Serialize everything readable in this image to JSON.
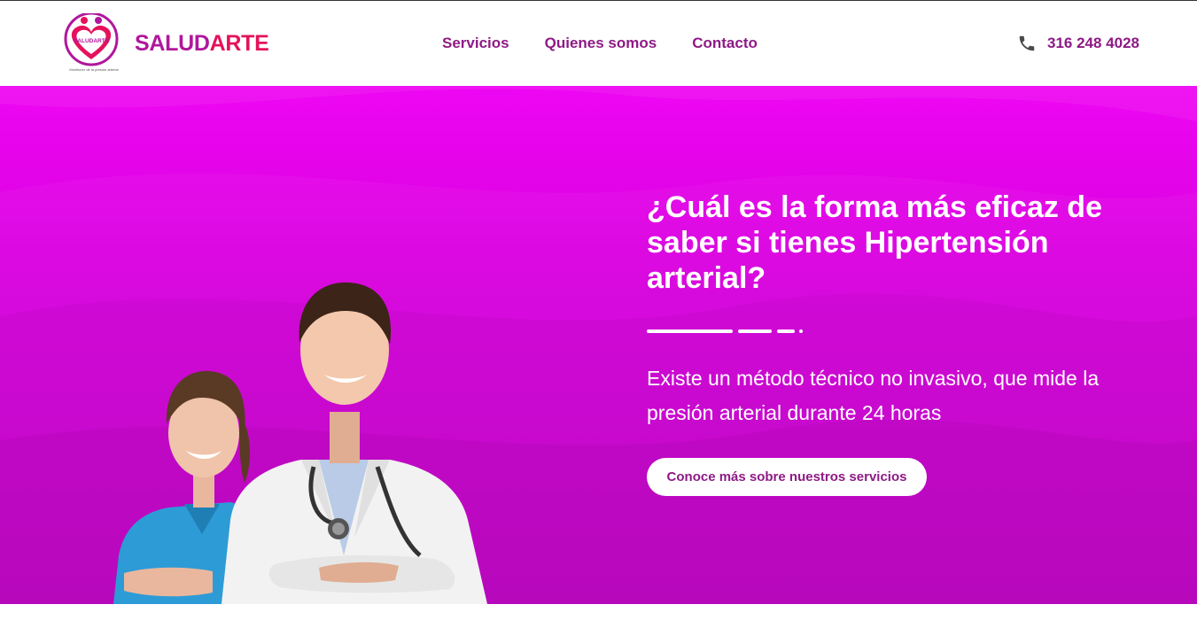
{
  "colors": {
    "brand_primary": "#b0179c",
    "brand_secondary": "#e5125b",
    "nav_text": "#8e1a86",
    "hero_top": "#ee06f3",
    "hero_bottom": "#c400c9",
    "white": "#ffffff"
  },
  "header": {
    "logo": {
      "badge_text": "SALUDARTE",
      "tagline": "Monitoreo de la presión arterial",
      "icon": "heart-logo-icon"
    },
    "brand": {
      "part1": "SALUD",
      "part2": "ARTE"
    },
    "nav": [
      {
        "label": "Servicios"
      },
      {
        "label": "Quienes somos"
      },
      {
        "label": "Contacto"
      }
    ],
    "phone": {
      "icon": "phone-icon",
      "number": "316 248 4028"
    }
  },
  "hero": {
    "image": "doctors-illustration",
    "headline": "¿Cuál es la forma más eficaz de saber si tienes Hipertensión arterial?",
    "subtext": "Existe un método técnico no invasivo, que mide la presión arterial durante 24 horas",
    "cta_label": "Conoce más sobre nuestros servicios"
  }
}
